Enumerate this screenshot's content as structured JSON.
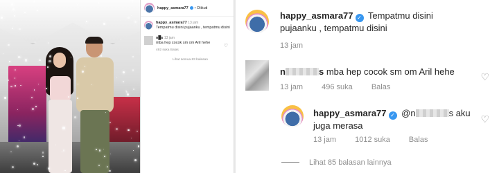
{
  "small_panel": {
    "header": {
      "username": "happy_asmara77",
      "dot": "•",
      "follow_status": "Diikuti"
    },
    "caption": {
      "username": "happy_asmara77",
      "time": "13 jam",
      "text": "Tempatmu disini pujaanku , tempatmu disini"
    },
    "comment": {
      "username": "n█s",
      "time": "13 jam",
      "text": "mba hep cocok sm om Aril hehe",
      "meta": "492 suka  Balas"
    },
    "view_replies": "Lihat semua 83 balasan"
  },
  "zoom_panel": {
    "caption": {
      "username": "happy_asmara77",
      "verified_icon": "✓",
      "text_line1": "Tempatmu disini",
      "text_line2": "pujaanku , tempatmu disini",
      "time": "13 jam"
    },
    "comment": {
      "username_start": "n",
      "username_end": "s",
      "text": "mba hep cocok sm om Aril hehe",
      "time": "13 jam",
      "likes": "496 suka",
      "reply_label": "Balas"
    },
    "reply": {
      "username": "happy_asmara77",
      "verified_icon": "✓",
      "mention_start": "@n",
      "mention_end": "s",
      "text_after": "aku",
      "text_line2": "juga merasa",
      "time": "13 jam",
      "likes": "1012 suka",
      "reply_label": "Balas"
    },
    "view_more": "Lihat 85 balasan lainnya"
  },
  "icons": {
    "heart": "♡"
  },
  "colors": {
    "verified": "#3897f0",
    "muted": "#8e8e8e",
    "text": "#262626"
  }
}
